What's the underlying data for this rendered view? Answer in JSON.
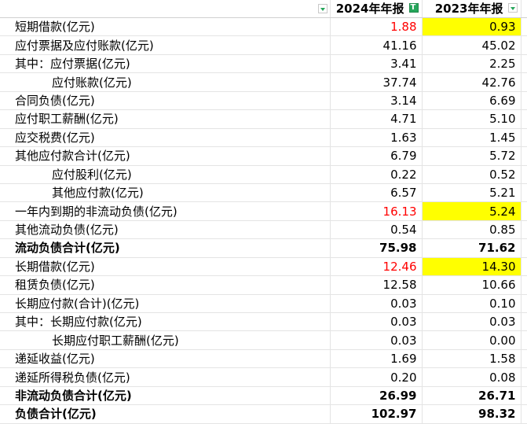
{
  "header": {
    "col_2024": "2024年年报",
    "col_2023": "2023年年报",
    "filter_active_glyph": "T"
  },
  "rows": [
    {
      "label": "短期借款(亿元)",
      "v2024": "1.88",
      "v2023": "0.93"
    },
    {
      "label": "应付票据及应付账款(亿元)",
      "v2024": "41.16",
      "v2023": "45.02"
    },
    {
      "label": "其中：应付票据(亿元)",
      "v2024": "3.41",
      "v2023": "2.25"
    },
    {
      "label": "应付账款(亿元)",
      "v2024": "37.74",
      "v2023": "42.76"
    },
    {
      "label": "合同负债(亿元)",
      "v2024": "3.14",
      "v2023": "6.69"
    },
    {
      "label": "应付职工薪酬(亿元)",
      "v2024": "4.71",
      "v2023": "5.10"
    },
    {
      "label": "应交税费(亿元)",
      "v2024": "1.63",
      "v2023": "1.45"
    },
    {
      "label": "其他应付款合计(亿元)",
      "v2024": "6.79",
      "v2023": "5.72"
    },
    {
      "label": "应付股利(亿元)",
      "v2024": "0.22",
      "v2023": "0.52"
    },
    {
      "label": "其他应付款(亿元)",
      "v2024": "6.57",
      "v2023": "5.21"
    },
    {
      "label": "一年内到期的非流动负债(亿元)",
      "v2024": "16.13",
      "v2023": "5.24"
    },
    {
      "label": "其他流动负债(亿元)",
      "v2024": "0.54",
      "v2023": "0.85"
    },
    {
      "label": "流动负债合计(亿元)",
      "v2024": "75.98",
      "v2023": "71.62"
    },
    {
      "label": "长期借款(亿元)",
      "v2024": "12.46",
      "v2023": "14.30"
    },
    {
      "label": "租赁负债(亿元)",
      "v2024": "12.58",
      "v2023": "10.66"
    },
    {
      "label": "长期应付款(合计)(亿元)",
      "v2024": "0.03",
      "v2023": "0.10"
    },
    {
      "label": "其中：长期应付款(亿元)",
      "v2024": "0.03",
      "v2023": "0.03"
    },
    {
      "label": "长期应付职工薪酬(亿元)",
      "v2024": "0.03",
      "v2023": "0.00"
    },
    {
      "label": "递延收益(亿元)",
      "v2024": "1.69",
      "v2023": "1.58"
    },
    {
      "label": "递延所得税负债(亿元)",
      "v2024": "0.20",
      "v2023": "0.08"
    },
    {
      "label": "非流动负债合计(亿元)",
      "v2024": "26.99",
      "v2023": "26.71"
    },
    {
      "label": "负债合计(亿元)",
      "v2024": "102.97",
      "v2023": "98.32"
    }
  ],
  "colors": {
    "highlight": "#ffff00",
    "red_text": "#ff0000",
    "filter_green": "#26a65b"
  }
}
